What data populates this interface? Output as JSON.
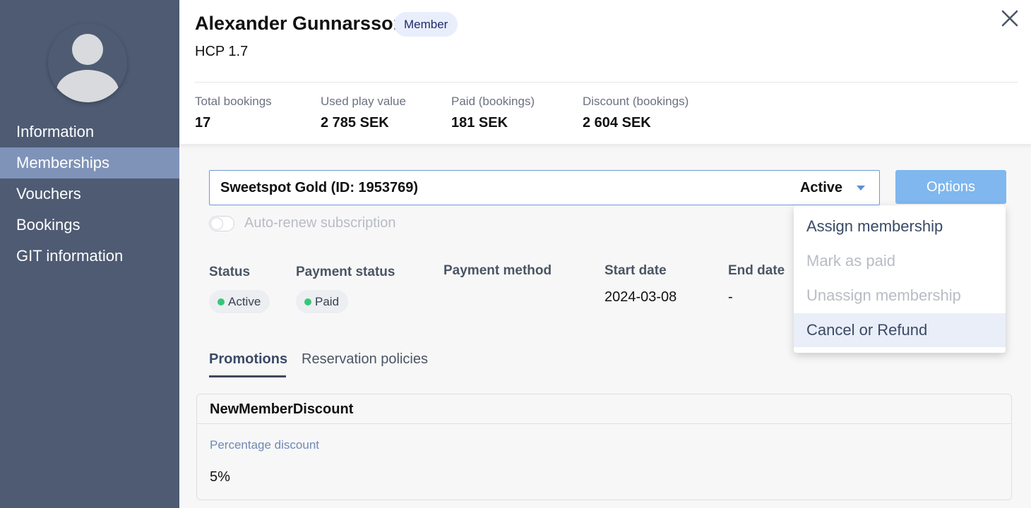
{
  "sidebar": {
    "nav": [
      {
        "label": "Information",
        "active": false
      },
      {
        "label": "Memberships",
        "active": true
      },
      {
        "label": "Vouchers",
        "active": false
      },
      {
        "label": "Bookings",
        "active": false
      },
      {
        "label": "GIT information",
        "active": false
      }
    ],
    "avatar_icon": "user-avatar-icon"
  },
  "header": {
    "name": "Alexander Gunnarsson",
    "badge": "Member",
    "hcp": "HCP 1.7",
    "close_icon": "close-icon",
    "stats": [
      {
        "label": "Total bookings",
        "value": "17"
      },
      {
        "label": "Used play value",
        "value": "2 785 SEK"
      },
      {
        "label": "Paid (bookings)",
        "value": "181 SEK"
      },
      {
        "label": "Discount (bookings)",
        "value": "2 604 SEK"
      }
    ]
  },
  "membership": {
    "name": "Sweetspot Gold (ID: 1953769)",
    "status": "Active",
    "options_label": "Options",
    "auto_renew_label": "Auto-renew subscription",
    "auto_renew_on": false
  },
  "details": {
    "status_label": "Status",
    "status_value": "Active",
    "payment_status_label": "Payment status",
    "payment_status_value": "Paid",
    "payment_method_label": "Payment method",
    "start_date_label": "Start date",
    "start_date_value": "2024-03-08",
    "end_date_label": "End date",
    "end_date_value": "-"
  },
  "tabs": [
    {
      "label": "Promotions",
      "active": true
    },
    {
      "label": "Reservation policies",
      "active": false
    }
  ],
  "promotion": {
    "title": "NewMemberDiscount",
    "label": "Percentage discount",
    "value": "5%"
  },
  "options_menu": [
    {
      "label": "Assign membership",
      "state": "enabled"
    },
    {
      "label": "Mark as paid",
      "state": "disabled"
    },
    {
      "label": "Unassign membership",
      "state": "disabled"
    },
    {
      "label": "Cancel or Refund",
      "state": "highlighted"
    }
  ],
  "colors": {
    "sidebar_bg": "#4e5b73",
    "sidebar_active": "#7f93b8",
    "accent_blue": "#7fb7ee",
    "status_green": "#34c77b"
  }
}
